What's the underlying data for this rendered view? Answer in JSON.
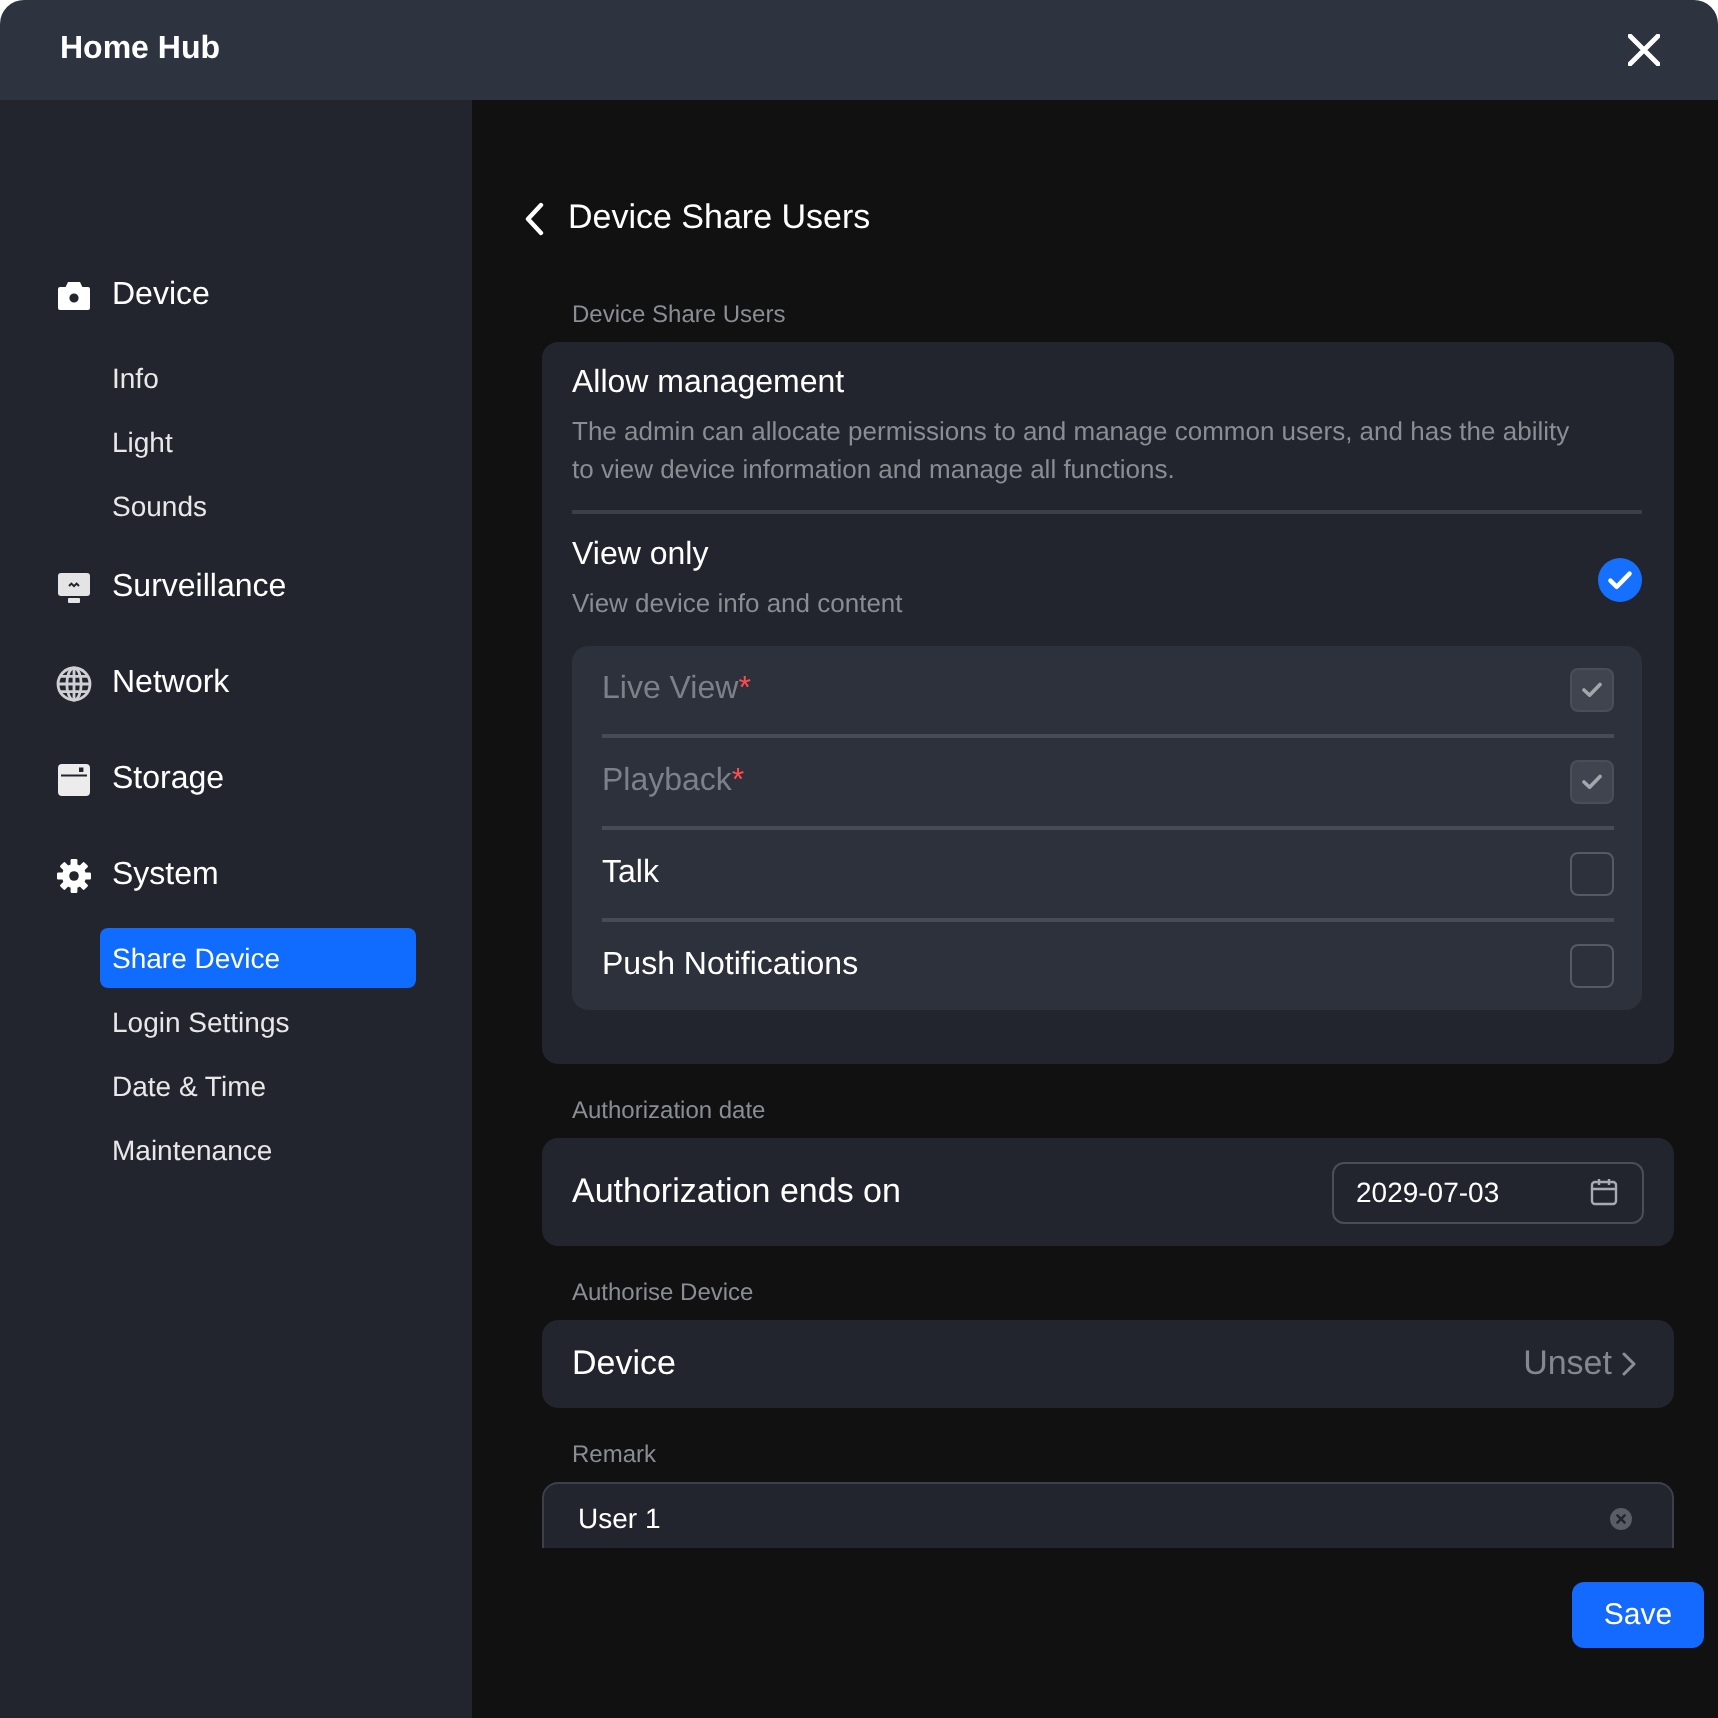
{
  "window": {
    "title": "Home Hub"
  },
  "sidebar": {
    "groups": [
      {
        "label": "Device",
        "children": [
          {
            "label": "Info",
            "selected": false
          },
          {
            "label": "Light",
            "selected": false
          },
          {
            "label": "Sounds",
            "selected": false
          }
        ]
      },
      {
        "label": "Surveillance"
      },
      {
        "label": "Network"
      },
      {
        "label": "Storage"
      },
      {
        "label": "System",
        "children": [
          {
            "label": "Share Device",
            "selected": true
          },
          {
            "label": "Login Settings",
            "selected": false
          },
          {
            "label": "Date & Time",
            "selected": false
          },
          {
            "label": "Maintenance",
            "selected": false
          }
        ]
      }
    ]
  },
  "page": {
    "title": "Device Share Users"
  },
  "share_users": {
    "heading": "Device Share Users",
    "roles": [
      {
        "title": "Allow management",
        "description": "The admin can allocate permissions to and manage common users, and has the ability to view device information and manage all functions.",
        "selected": false
      },
      {
        "title": "View only",
        "description": "View device info and content",
        "selected": true
      }
    ],
    "permissions": [
      {
        "label": "Live View",
        "required_mark": "*",
        "checked": true,
        "disabled": true
      },
      {
        "label": "Playback",
        "required_mark": "*",
        "checked": true,
        "disabled": true
      },
      {
        "label": "Talk",
        "checked": false,
        "disabled": false
      },
      {
        "label": "Push Notifications",
        "checked": false,
        "disabled": false
      }
    ]
  },
  "authorization": {
    "heading": "Authorization date",
    "label": "Authorization ends on",
    "date": "2029-07-03"
  },
  "authorise_device": {
    "heading": "Authorise Device",
    "label": "Device",
    "value": "Unset"
  },
  "remark": {
    "heading": "Remark",
    "value": "User 1"
  },
  "buttons": [
    {
      "label": "Save"
    }
  ]
}
